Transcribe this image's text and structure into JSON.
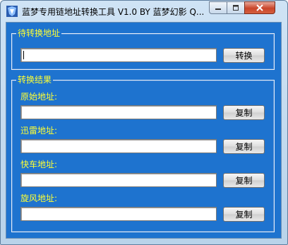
{
  "window": {
    "title": "蓝梦专用链地址转换工具 V1.0 BY 蓝梦幻影 Q..."
  },
  "input_group": {
    "legend": "待转换地址",
    "field_value": "",
    "convert_label": "转换"
  },
  "result_group": {
    "legend": "转换结果",
    "rows": [
      {
        "label": "原始地址:",
        "value": "",
        "copy_label": "复制"
      },
      {
        "label": "迅雷地址:",
        "value": "",
        "copy_label": "复制"
      },
      {
        "label": "快车地址:",
        "value": "",
        "copy_label": "复制"
      },
      {
        "label": "旋风地址:",
        "value": "",
        "copy_label": "复制"
      }
    ]
  },
  "colors": {
    "client_bg": "#1e73cf",
    "label_text": "#ffff33",
    "close_button": "#c9452a"
  },
  "icons": [
    "app-icon",
    "minimize-icon",
    "maximize-icon",
    "close-icon"
  ]
}
